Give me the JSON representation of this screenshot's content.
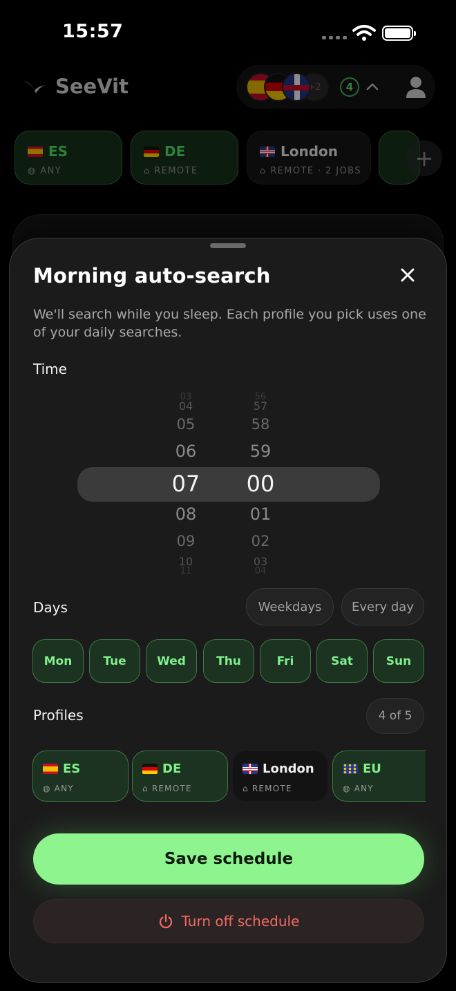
{
  "status_bar": {
    "time": "15:57"
  },
  "app": {
    "name": "SeeVit"
  },
  "header": {
    "more_flags": "+2",
    "active_count": "4"
  },
  "top_chips": [
    {
      "label": "ES",
      "sub": "ANY",
      "flag": "es",
      "active": true
    },
    {
      "label": "DE",
      "sub": "REMOTE",
      "flag": "de",
      "active": true
    },
    {
      "label": "London",
      "sub": "REMOTE · 2 JOBS",
      "flag": "gb",
      "active": false
    }
  ],
  "sheet": {
    "title": "Morning auto-search",
    "subtitle": "We'll search while you sleep. Each profile you pick uses one of your daily searches.",
    "time_label": "Time",
    "hours": [
      "03",
      "04",
      "05",
      "06",
      "07",
      "08",
      "09",
      "10",
      "11"
    ],
    "minutes": [
      "56",
      "57",
      "58",
      "59",
      "00",
      "01",
      "02",
      "03",
      "04"
    ],
    "selected_hour": "07",
    "selected_minute": "00",
    "days_label": "Days",
    "presets": [
      "Weekdays",
      "Every day"
    ],
    "days": [
      {
        "label": "Mon",
        "selected": true
      },
      {
        "label": "Tue",
        "selected": true
      },
      {
        "label": "Wed",
        "selected": true
      },
      {
        "label": "Thu",
        "selected": true
      },
      {
        "label": "Fri",
        "selected": true
      },
      {
        "label": "Sat",
        "selected": true
      },
      {
        "label": "Sun",
        "selected": true
      }
    ],
    "profiles_label": "Profiles",
    "profiles_count": "4 of 5",
    "profiles": [
      {
        "label": "ES",
        "sub": "ANY",
        "flag": "es",
        "selected": true
      },
      {
        "label": "DE",
        "sub": "REMOTE",
        "flag": "de",
        "selected": true
      },
      {
        "label": "London",
        "sub": "REMOTE",
        "flag": "gb",
        "selected": false
      },
      {
        "label": "EU",
        "sub": "ANY",
        "flag": "eu",
        "selected": true
      }
    ],
    "save_label": "Save schedule",
    "turn_off_label": "Turn off schedule"
  },
  "colors": {
    "accent": "#8ef58e",
    "accent_text": "#7ff08c",
    "danger": "#f26b63",
    "sheet_bg": "#1c1c1c"
  }
}
